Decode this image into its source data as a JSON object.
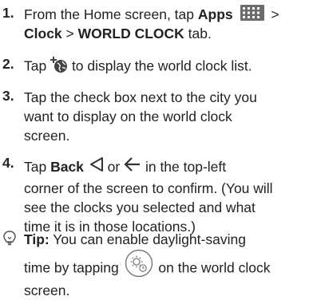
{
  "steps": [
    {
      "number": "1.",
      "line1_pre": "From the Home screen, tap ",
      "apps": "Apps",
      "line1_post": " >",
      "clock": "Clock",
      "sep": " > ",
      "world_clock_tab": "WORLD CLOCK",
      "tab_suffix": " tab."
    },
    {
      "number": "2.",
      "pre": "Tap ",
      "post": " to display the world clock list."
    },
    {
      "number": "3.",
      "lines": [
        "Tap the check box next to the city you",
        "want to display on the world clock",
        "screen."
      ]
    },
    {
      "number": "4.",
      "pre": "Tap ",
      "back": "Back",
      "mid": " or ",
      "post": " in the top-left",
      "lines": [
        "corner of the screen to confirm. (You will",
        "see the clocks you selected and what",
        "time it is in those locations.)"
      ]
    }
  ],
  "tip": {
    "label": "Tip:",
    "line1": " You can enable daylight-saving",
    "line2_pre": "time by tapping ",
    "line2_post": " on the world clock",
    "line3": "screen."
  },
  "icons": {
    "apps": "apps-grid-icon",
    "add_city": "add-city-globe-icon",
    "back_triangle": "back-triangle-icon",
    "back_arrow": "back-arrow-icon",
    "tip": "lightbulb-icon",
    "daylight": "daylight-saving-icon"
  },
  "colors": {
    "text": "#222222",
    "icon": "#555555"
  }
}
